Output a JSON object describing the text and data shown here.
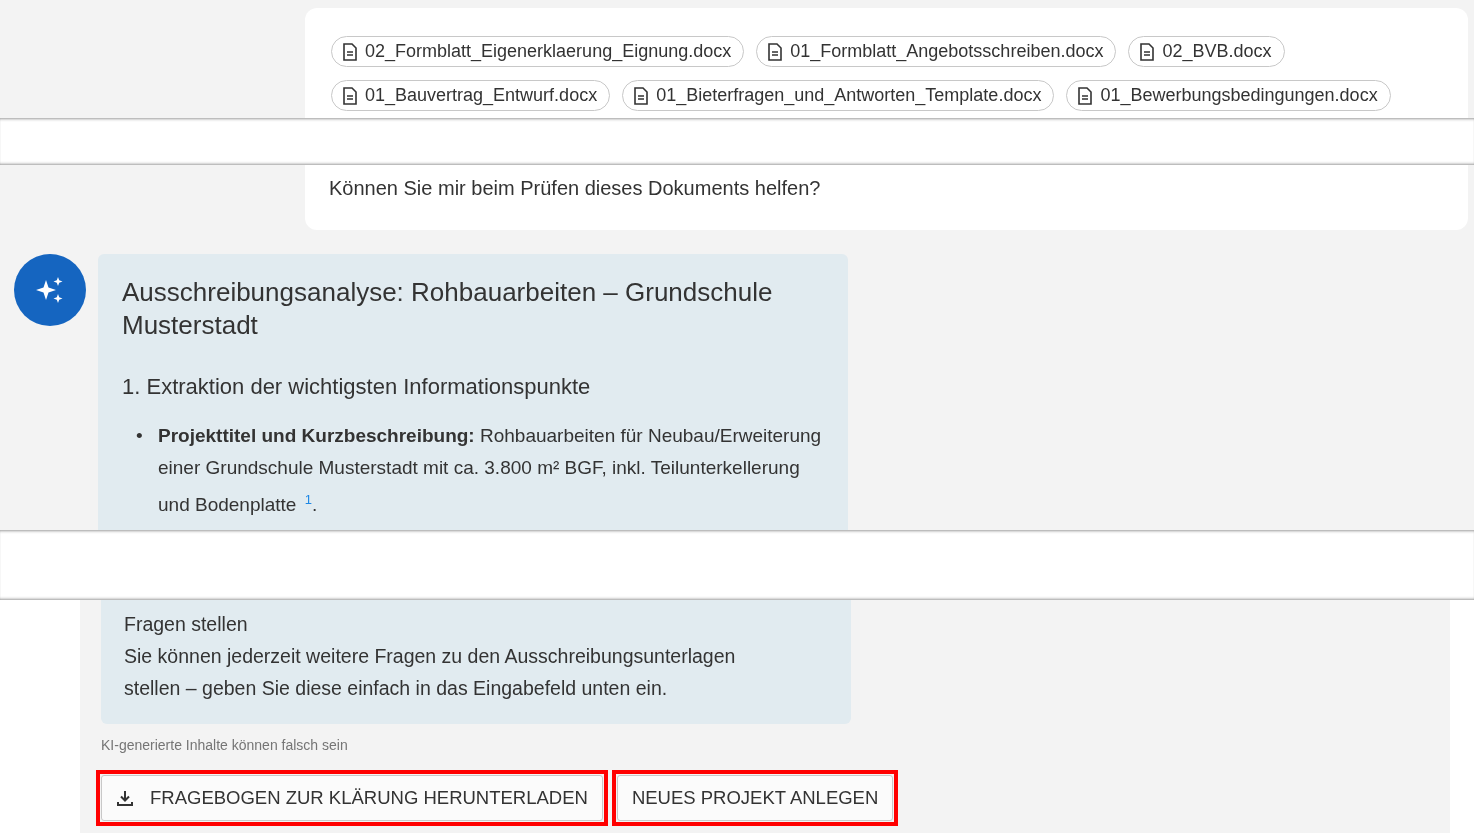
{
  "prompt": {
    "attachments": [
      {
        "name": "02_Formblatt_Eigenerklaerung_Eignung.docx"
      },
      {
        "name": "01_Formblatt_Angebotsschreiben.docx"
      },
      {
        "name": "02_BVB.docx"
      },
      {
        "name": "01_Bauvertrag_Entwurf.docx"
      },
      {
        "name": "01_Bieterfragen_und_Antworten_Template.docx"
      },
      {
        "name": "01_Bewerbungsbedingungen.docx"
      }
    ],
    "question": "Können Sie mir beim Prüfen dieses Dokuments helfen?"
  },
  "answer": {
    "title": "Ausschreibungsanalyse: Rohbauarbeiten – Grundschule Musterstadt",
    "section": "1. Extraktion der wichtigsten Informationspunkte",
    "bullets": [
      {
        "marker": "•",
        "text": "**Projekttitel und Kurzbeschreibung:** Rohbauarbeiten für Neubau/Erweiterung einer Grundschule Musterstadt mit ca. 3.800 m² BGF, inkl. Teilunterkellerung und Bodenplatte $^{1}$."
      }
    ]
  },
  "closing": {
    "heading": "Fragen stellen",
    "text": "Sie können jederzeit weitere Fragen zu den Ausschreibungsunterlagen stellen – geben Sie diese einfach in das Eingabefeld unten ein."
  },
  "disclaimer": "KI-generierte Inhalte können falsch sein",
  "actions": [
    {
      "label": "FRAGEBOGEN ZUR KLÄRUNG HERUNTERLADEN",
      "kind": "download"
    },
    {
      "label": "NEUES PROJEKT ANLEGEN",
      "kind": "plain"
    }
  ]
}
